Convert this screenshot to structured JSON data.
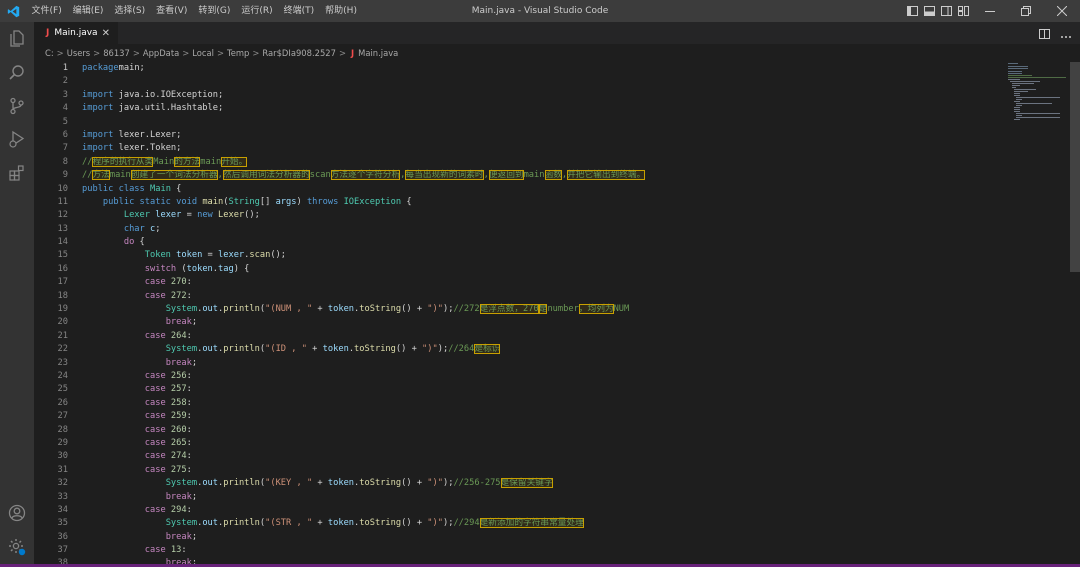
{
  "window": {
    "title": "Main.java - Visual Studio Code"
  },
  "menu": [
    "文件(F)",
    "编辑(E)",
    "选择(S)",
    "查看(V)",
    "转到(G)",
    "运行(R)",
    "终端(T)",
    "帮助(H)"
  ],
  "tab": {
    "label": "Main.java",
    "lang_badge": "J",
    "close": "✕"
  },
  "breadcrumb": [
    "C:",
    "Users",
    "86137",
    "AppData",
    "Local",
    "Temp",
    "Rar$DIa908.2527"
  ],
  "breadcrumb_file": "Main.java",
  "breadcrumb_sep": ">",
  "activity_icons": [
    "explorer-icon",
    "search-icon",
    "source-control-icon",
    "run-debug-icon",
    "extensions-icon",
    "account-icon",
    "manage-gear-icon"
  ],
  "active_line": 1,
  "code_lines": [
    [
      [
        "kw",
        "package"
      ],
      [
        "",
        "main;"
      ]
    ],
    [],
    [
      [
        "kw",
        "import"
      ],
      [
        "",
        " java.io.IOException;"
      ]
    ],
    [
      [
        "kw",
        "import"
      ],
      [
        "",
        " java.util.Hashtable;"
      ]
    ],
    [],
    [
      [
        "kw",
        "import"
      ],
      [
        "",
        " lexer.Lexer;"
      ]
    ],
    [
      [
        "kw",
        "import"
      ],
      [
        "",
        " lexer.Token;"
      ]
    ],
    [
      [
        "cmt",
        "//"
      ],
      [
        "cmt hl",
        "程序的执行从类"
      ],
      [
        "cmt",
        "Main"
      ],
      [
        "cmt hl",
        "的方法"
      ],
      [
        "cmt",
        "main"
      ],
      [
        "cmt hl",
        "开始。"
      ]
    ],
    [
      [
        "cmt",
        "//"
      ],
      [
        "cmt hl",
        "方法"
      ],
      [
        "cmt",
        "main"
      ],
      [
        "cmt hl",
        "创建了一个词法分析器"
      ],
      [
        "cmt",
        ","
      ],
      [
        "cmt hl",
        "然后调用词法分析器的"
      ],
      [
        "cmt",
        "scan"
      ],
      [
        "cmt hl",
        "方法逐个字符分析"
      ],
      [
        "cmt",
        ","
      ],
      [
        "cmt hl",
        "每当出现新的词素时"
      ],
      [
        "cmt",
        ","
      ],
      [
        "cmt hl",
        "便返回到"
      ],
      [
        "cmt",
        "main"
      ],
      [
        "cmt hl",
        "函数"
      ],
      [
        "cmt",
        ","
      ],
      [
        "cmt hl",
        "并把它输出到终端。"
      ]
    ],
    [
      [
        "kw",
        "public class "
      ],
      [
        "ty",
        "Main"
      ],
      [
        "",
        " {"
      ]
    ],
    [
      [
        "",
        "    "
      ],
      [
        "kw",
        "public static void "
      ],
      [
        "fn",
        "main"
      ],
      [
        "",
        "("
      ],
      [
        "ty",
        "String"
      ],
      [
        "",
        "[] "
      ],
      [
        "var",
        "args"
      ],
      [
        "",
        ") "
      ],
      [
        "kw",
        "throws "
      ],
      [
        "ty",
        "IOException"
      ],
      [
        "",
        " {"
      ]
    ],
    [
      [
        "",
        "        "
      ],
      [
        "ty",
        "Lexer "
      ],
      [
        "var",
        "lexer"
      ],
      [
        "",
        " = "
      ],
      [
        "kw",
        "new "
      ],
      [
        "fn",
        "Lexer"
      ],
      [
        "",
        "();"
      ]
    ],
    [
      [
        "",
        "        "
      ],
      [
        "kw",
        "char "
      ],
      [
        "var",
        "c"
      ],
      [
        "",
        ";"
      ]
    ],
    [
      [
        "",
        "        "
      ],
      [
        "ctl",
        "do"
      ],
      [
        "",
        " {"
      ]
    ],
    [
      [
        "",
        "            "
      ],
      [
        "ty",
        "Token "
      ],
      [
        "var",
        "token"
      ],
      [
        "",
        " = "
      ],
      [
        "var",
        "lexer"
      ],
      [
        "",
        "."
      ],
      [
        "fn",
        "scan"
      ],
      [
        "",
        "();"
      ]
    ],
    [
      [
        "",
        "            "
      ],
      [
        "ctl",
        "switch"
      ],
      [
        "",
        " ("
      ],
      [
        "var",
        "token"
      ],
      [
        "",
        "."
      ],
      [
        "var",
        "tag"
      ],
      [
        "",
        ") {"
      ]
    ],
    [
      [
        "",
        "            "
      ],
      [
        "ctl",
        "case "
      ],
      [
        "num",
        "270"
      ],
      [
        "",
        ":"
      ]
    ],
    [
      [
        "",
        "            "
      ],
      [
        "ctl",
        "case "
      ],
      [
        "num",
        "272"
      ],
      [
        "",
        ":"
      ]
    ],
    [
      [
        "",
        "                "
      ],
      [
        "ty",
        "System"
      ],
      [
        "",
        "."
      ],
      [
        "var",
        "out"
      ],
      [
        "",
        "."
      ],
      [
        "fn",
        "println"
      ],
      [
        "",
        "("
      ],
      [
        "str",
        "\"(NUM , \""
      ],
      [
        "",
        " + "
      ],
      [
        "var",
        "token"
      ],
      [
        "",
        "."
      ],
      [
        "fn",
        "toString"
      ],
      [
        "",
        "() + "
      ],
      [
        "str",
        "\")\""
      ],
      [
        "",
        ");"
      ],
      [
        "cmt",
        "//272"
      ],
      [
        "cmt hl",
        "是浮点数，270"
      ],
      [
        "cmt hl",
        "是"
      ],
      [
        "cmt",
        "number"
      ],
      [
        "cmt hl",
        "，均列为"
      ],
      [
        "cmt",
        "NUM"
      ]
    ],
    [
      [
        "",
        "                "
      ],
      [
        "ctl",
        "break"
      ],
      [
        "",
        ";"
      ]
    ],
    [
      [
        "",
        "            "
      ],
      [
        "ctl",
        "case "
      ],
      [
        "num",
        "264"
      ],
      [
        "",
        ":"
      ]
    ],
    [
      [
        "",
        "                "
      ],
      [
        "ty",
        "System"
      ],
      [
        "",
        "."
      ],
      [
        "var",
        "out"
      ],
      [
        "",
        "."
      ],
      [
        "fn",
        "println"
      ],
      [
        "",
        "("
      ],
      [
        "str",
        "\"(ID , \""
      ],
      [
        "",
        " + "
      ],
      [
        "var",
        "token"
      ],
      [
        "",
        "."
      ],
      [
        "fn",
        "toString"
      ],
      [
        "",
        "() + "
      ],
      [
        "str",
        "\")\""
      ],
      [
        "",
        ");"
      ],
      [
        "cmt",
        "//264"
      ],
      [
        "cmt hl",
        "是标识"
      ]
    ],
    [
      [
        "",
        "                "
      ],
      [
        "ctl",
        "break"
      ],
      [
        "",
        ";"
      ]
    ],
    [
      [
        "",
        "            "
      ],
      [
        "ctl",
        "case "
      ],
      [
        "num",
        "256"
      ],
      [
        "",
        ":"
      ]
    ],
    [
      [
        "",
        "            "
      ],
      [
        "ctl",
        "case "
      ],
      [
        "num",
        "257"
      ],
      [
        "",
        ":"
      ]
    ],
    [
      [
        "",
        "            "
      ],
      [
        "ctl",
        "case "
      ],
      [
        "num",
        "258"
      ],
      [
        "",
        ":"
      ]
    ],
    [
      [
        "",
        "            "
      ],
      [
        "ctl",
        "case "
      ],
      [
        "num",
        "259"
      ],
      [
        "",
        ":"
      ]
    ],
    [
      [
        "",
        "            "
      ],
      [
        "ctl",
        "case "
      ],
      [
        "num",
        "260"
      ],
      [
        "",
        ":"
      ]
    ],
    [
      [
        "",
        "            "
      ],
      [
        "ctl",
        "case "
      ],
      [
        "num",
        "265"
      ],
      [
        "",
        ":"
      ]
    ],
    [
      [
        "",
        "            "
      ],
      [
        "ctl",
        "case "
      ],
      [
        "num",
        "274"
      ],
      [
        "",
        ":"
      ]
    ],
    [
      [
        "",
        "            "
      ],
      [
        "ctl",
        "case "
      ],
      [
        "num",
        "275"
      ],
      [
        "",
        ":"
      ]
    ],
    [
      [
        "",
        "                "
      ],
      [
        "ty",
        "System"
      ],
      [
        "",
        "."
      ],
      [
        "var",
        "out"
      ],
      [
        "",
        "."
      ],
      [
        "fn",
        "println"
      ],
      [
        "",
        "("
      ],
      [
        "str",
        "\"(KEY , \""
      ],
      [
        "",
        " + "
      ],
      [
        "var",
        "token"
      ],
      [
        "",
        "."
      ],
      [
        "fn",
        "toString"
      ],
      [
        "",
        "() + "
      ],
      [
        "str",
        "\")\""
      ],
      [
        "",
        ");"
      ],
      [
        "cmt",
        "//256-275"
      ],
      [
        "cmt hl",
        "是保留关键字"
      ]
    ],
    [
      [
        "",
        "                "
      ],
      [
        "ctl",
        "break"
      ],
      [
        "",
        ";"
      ]
    ],
    [
      [
        "",
        "            "
      ],
      [
        "ctl",
        "case "
      ],
      [
        "num",
        "294"
      ],
      [
        "",
        ":"
      ]
    ],
    [
      [
        "",
        "                "
      ],
      [
        "ty",
        "System"
      ],
      [
        "",
        "."
      ],
      [
        "var",
        "out"
      ],
      [
        "",
        "."
      ],
      [
        "fn",
        "println"
      ],
      [
        "",
        "("
      ],
      [
        "str",
        "\"(STR , \""
      ],
      [
        "",
        " + "
      ],
      [
        "var",
        "token"
      ],
      [
        "",
        "."
      ],
      [
        "fn",
        "toString"
      ],
      [
        "",
        "() + "
      ],
      [
        "str",
        "\")\""
      ],
      [
        "",
        ");"
      ],
      [
        "cmt",
        "//294"
      ],
      [
        "cmt hl",
        "是新添加的字符串常量处理"
      ]
    ],
    [
      [
        "",
        "                "
      ],
      [
        "ctl",
        "break"
      ],
      [
        "",
        ";"
      ]
    ],
    [
      [
        "",
        "            "
      ],
      [
        "ctl",
        "case "
      ],
      [
        "num",
        "13"
      ],
      [
        "",
        ":"
      ]
    ],
    [
      [
        "",
        "                "
      ],
      [
        "ctl",
        "break"
      ],
      [
        "",
        ";"
      ]
    ]
  ],
  "colors": {
    "accent": "#007acc",
    "status_bar": "#68217a",
    "highlight_box": "#c8a000"
  }
}
